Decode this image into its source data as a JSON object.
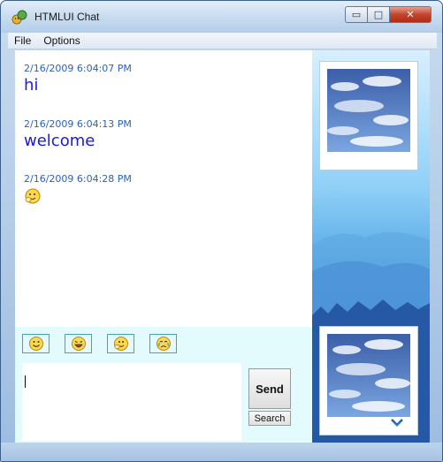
{
  "window": {
    "title": "HTMLUI Chat",
    "controls": {
      "minimize": "▭",
      "maximize": "□",
      "close": "✕"
    }
  },
  "menu": {
    "items": [
      {
        "label": "File"
      },
      {
        "label": "Options"
      }
    ]
  },
  "chat": {
    "messages": [
      {
        "time": "2/16/2009 6:04:07 PM",
        "text": "hi",
        "type": "text"
      },
      {
        "time": "2/16/2009 6:04:13 PM",
        "text": "welcome",
        "type": "text"
      },
      {
        "time": "2/16/2009 6:04:28 PM",
        "text": "",
        "type": "emoticon",
        "icon": "clapping-smiley-icon"
      }
    ]
  },
  "emoticons": [
    {
      "icon": "smile-icon"
    },
    {
      "icon": "laughing-icon"
    },
    {
      "icon": "clapping-icon"
    },
    {
      "icon": "crying-icon"
    }
  ],
  "composer": {
    "input_value": "",
    "send_label": "Send",
    "search_label": "Search"
  },
  "sidebar": {
    "photos": [
      {
        "icon": "sky-clouds-photo"
      },
      {
        "icon": "sky-clouds-photo"
      }
    ],
    "expand_icon": "chevron-down-icon"
  },
  "colors": {
    "timestamp": "#2a62b8",
    "message_text": "#1b1bd6",
    "panel_bg": "#e3fbfd",
    "accent_blue": "#3883d4"
  }
}
